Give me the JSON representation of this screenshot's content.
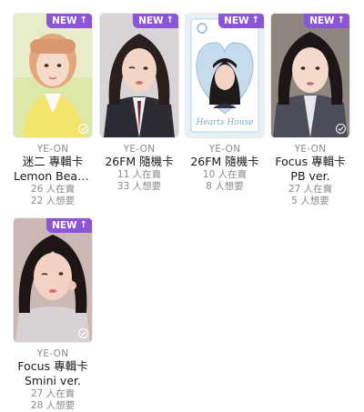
{
  "badge": {
    "label": "NEW",
    "icon": "arrow-up-icon"
  },
  "colors": {
    "badge_bg": "#8b55d6",
    "secondary_text": "#8a8a8a"
  },
  "cards": [
    {
      "artist": "YE-ON",
      "title": "迷二 專輯卡",
      "subtitle": "Lemon Beach ...",
      "owned": "26 人在賣",
      "wanted": "22 人想要"
    },
    {
      "artist": "YE-ON",
      "title": "26FM 隨機卡",
      "subtitle": "",
      "owned": "11 人在賣",
      "wanted": "33 人想要"
    },
    {
      "artist": "YE-ON",
      "title": "26FM 隨機卡",
      "subtitle": "",
      "owned": "10 人在賣",
      "wanted": "8 人想要"
    },
    {
      "artist": "YE-ON",
      "title": "Focus 專輯卡",
      "subtitle": "PB ver.",
      "owned": "27 人在賣",
      "wanted": "5 人想要"
    },
    {
      "artist": "YE-ON",
      "title": "Focus 專輯卡",
      "subtitle": "Smini ver.",
      "owned": "27 人在賣",
      "wanted": "28 人想要"
    }
  ]
}
